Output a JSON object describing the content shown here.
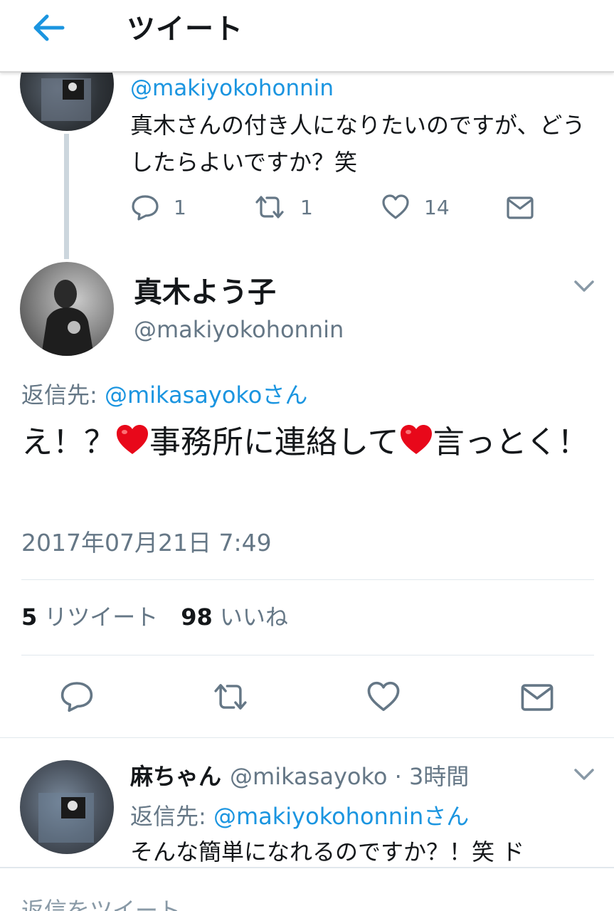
{
  "header": {
    "title": "ツイート",
    "back_icon": "back-arrow-icon"
  },
  "previous_tweet": {
    "handle": "@makiyokohonnin",
    "text": "真木さんの付き人になりたいのですが、どうしたらよいですか？笑",
    "actions": {
      "replies": "1",
      "retweets": "1",
      "likes": "14"
    }
  },
  "main_tweet": {
    "name": "真木よう子",
    "handle": "@makiyokohonnin",
    "reply_prefix": "返信先:",
    "reply_target": "@mikasayokoさん",
    "text_part1": "え！？",
    "text_part2": "事務所に連絡して",
    "text_part3": "言っとく！",
    "timestamp": "2017年07月21日 7:49",
    "retweet_count": "5",
    "retweet_label": "リツイート",
    "like_count": "98",
    "like_label": "いいね"
  },
  "reply_tweet": {
    "name": "麻ちゃん",
    "handle_time": "@mikasayoko · 3時間",
    "reply_prefix": "返信先:",
    "reply_target": "@makiyokohonninさん",
    "text": "そんな簡単になれるのですか？！笑 ド"
  },
  "compose": {
    "placeholder": "返信をツイート"
  },
  "colors": {
    "accent": "#1b95e0",
    "secondary_text": "#657786",
    "heart": "#e0245e",
    "divider": "#e1e8ed"
  }
}
